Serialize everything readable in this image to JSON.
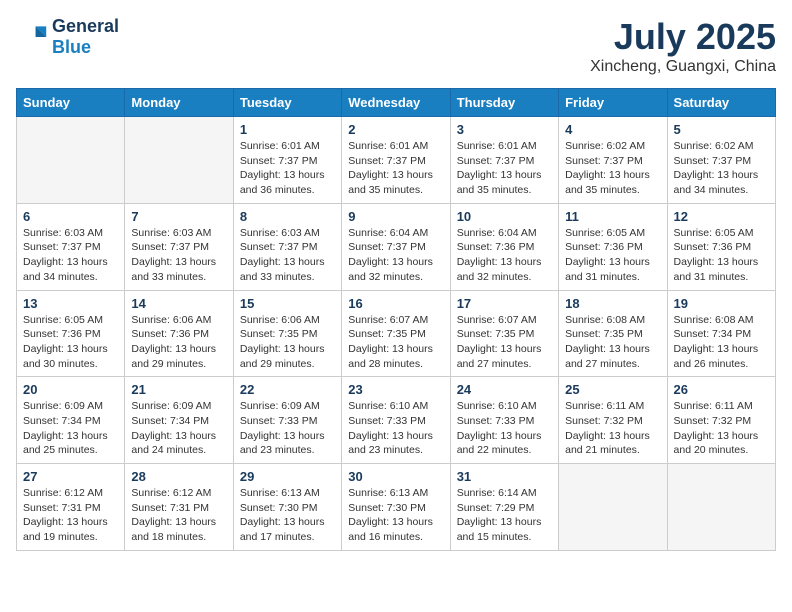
{
  "header": {
    "logo_line1": "General",
    "logo_line2": "Blue",
    "month_year": "July 2025",
    "location": "Xincheng, Guangxi, China"
  },
  "weekdays": [
    "Sunday",
    "Monday",
    "Tuesday",
    "Wednesday",
    "Thursday",
    "Friday",
    "Saturday"
  ],
  "weeks": [
    [
      {
        "day": "",
        "info": ""
      },
      {
        "day": "",
        "info": ""
      },
      {
        "day": "1",
        "info": "Sunrise: 6:01 AM\nSunset: 7:37 PM\nDaylight: 13 hours\nand 36 minutes."
      },
      {
        "day": "2",
        "info": "Sunrise: 6:01 AM\nSunset: 7:37 PM\nDaylight: 13 hours\nand 35 minutes."
      },
      {
        "day": "3",
        "info": "Sunrise: 6:01 AM\nSunset: 7:37 PM\nDaylight: 13 hours\nand 35 minutes."
      },
      {
        "day": "4",
        "info": "Sunrise: 6:02 AM\nSunset: 7:37 PM\nDaylight: 13 hours\nand 35 minutes."
      },
      {
        "day": "5",
        "info": "Sunrise: 6:02 AM\nSunset: 7:37 PM\nDaylight: 13 hours\nand 34 minutes."
      }
    ],
    [
      {
        "day": "6",
        "info": "Sunrise: 6:03 AM\nSunset: 7:37 PM\nDaylight: 13 hours\nand 34 minutes."
      },
      {
        "day": "7",
        "info": "Sunrise: 6:03 AM\nSunset: 7:37 PM\nDaylight: 13 hours\nand 33 minutes."
      },
      {
        "day": "8",
        "info": "Sunrise: 6:03 AM\nSunset: 7:37 PM\nDaylight: 13 hours\nand 33 minutes."
      },
      {
        "day": "9",
        "info": "Sunrise: 6:04 AM\nSunset: 7:37 PM\nDaylight: 13 hours\nand 32 minutes."
      },
      {
        "day": "10",
        "info": "Sunrise: 6:04 AM\nSunset: 7:36 PM\nDaylight: 13 hours\nand 32 minutes."
      },
      {
        "day": "11",
        "info": "Sunrise: 6:05 AM\nSunset: 7:36 PM\nDaylight: 13 hours\nand 31 minutes."
      },
      {
        "day": "12",
        "info": "Sunrise: 6:05 AM\nSunset: 7:36 PM\nDaylight: 13 hours\nand 31 minutes."
      }
    ],
    [
      {
        "day": "13",
        "info": "Sunrise: 6:05 AM\nSunset: 7:36 PM\nDaylight: 13 hours\nand 30 minutes."
      },
      {
        "day": "14",
        "info": "Sunrise: 6:06 AM\nSunset: 7:36 PM\nDaylight: 13 hours\nand 29 minutes."
      },
      {
        "day": "15",
        "info": "Sunrise: 6:06 AM\nSunset: 7:35 PM\nDaylight: 13 hours\nand 29 minutes."
      },
      {
        "day": "16",
        "info": "Sunrise: 6:07 AM\nSunset: 7:35 PM\nDaylight: 13 hours\nand 28 minutes."
      },
      {
        "day": "17",
        "info": "Sunrise: 6:07 AM\nSunset: 7:35 PM\nDaylight: 13 hours\nand 27 minutes."
      },
      {
        "day": "18",
        "info": "Sunrise: 6:08 AM\nSunset: 7:35 PM\nDaylight: 13 hours\nand 27 minutes."
      },
      {
        "day": "19",
        "info": "Sunrise: 6:08 AM\nSunset: 7:34 PM\nDaylight: 13 hours\nand 26 minutes."
      }
    ],
    [
      {
        "day": "20",
        "info": "Sunrise: 6:09 AM\nSunset: 7:34 PM\nDaylight: 13 hours\nand 25 minutes."
      },
      {
        "day": "21",
        "info": "Sunrise: 6:09 AM\nSunset: 7:34 PM\nDaylight: 13 hours\nand 24 minutes."
      },
      {
        "day": "22",
        "info": "Sunrise: 6:09 AM\nSunset: 7:33 PM\nDaylight: 13 hours\nand 23 minutes."
      },
      {
        "day": "23",
        "info": "Sunrise: 6:10 AM\nSunset: 7:33 PM\nDaylight: 13 hours\nand 23 minutes."
      },
      {
        "day": "24",
        "info": "Sunrise: 6:10 AM\nSunset: 7:33 PM\nDaylight: 13 hours\nand 22 minutes."
      },
      {
        "day": "25",
        "info": "Sunrise: 6:11 AM\nSunset: 7:32 PM\nDaylight: 13 hours\nand 21 minutes."
      },
      {
        "day": "26",
        "info": "Sunrise: 6:11 AM\nSunset: 7:32 PM\nDaylight: 13 hours\nand 20 minutes."
      }
    ],
    [
      {
        "day": "27",
        "info": "Sunrise: 6:12 AM\nSunset: 7:31 PM\nDaylight: 13 hours\nand 19 minutes."
      },
      {
        "day": "28",
        "info": "Sunrise: 6:12 AM\nSunset: 7:31 PM\nDaylight: 13 hours\nand 18 minutes."
      },
      {
        "day": "29",
        "info": "Sunrise: 6:13 AM\nSunset: 7:30 PM\nDaylight: 13 hours\nand 17 minutes."
      },
      {
        "day": "30",
        "info": "Sunrise: 6:13 AM\nSunset: 7:30 PM\nDaylight: 13 hours\nand 16 minutes."
      },
      {
        "day": "31",
        "info": "Sunrise: 6:14 AM\nSunset: 7:29 PM\nDaylight: 13 hours\nand 15 minutes."
      },
      {
        "day": "",
        "info": ""
      },
      {
        "day": "",
        "info": ""
      }
    ]
  ]
}
